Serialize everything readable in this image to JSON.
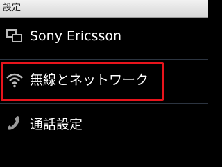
{
  "status_bar": {
    "title": "設定"
  },
  "settings_list": {
    "items": [
      {
        "label": "Sony Ericsson",
        "icon": "windows-icon"
      },
      {
        "label": "無線とネットワーク",
        "icon": "wifi-icon"
      },
      {
        "label": "通話設定",
        "icon": "phone-handset-icon"
      }
    ]
  },
  "colors": {
    "highlight_border": "#e8141c",
    "background": "#000000"
  }
}
